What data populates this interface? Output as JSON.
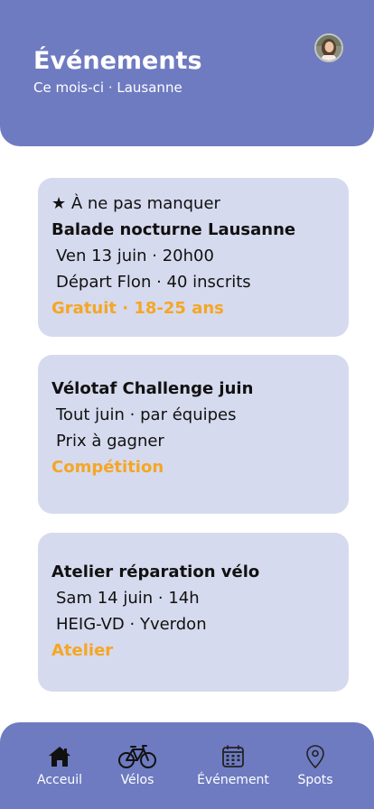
{
  "header": {
    "title": "Événements",
    "subtitle": "Ce mois-ci · Lausanne"
  },
  "events": [
    {
      "highlight": "★ À ne pas manquer",
      "title": "Balade nocturne Lausanne",
      "line1": "Ven 13 juin · 20h00",
      "line2": "Départ Flon · 40 inscrits",
      "tag": "Gratuit · 18-25 ans"
    },
    {
      "title": "Vélotaf Challenge juin",
      "line1": "Tout juin · par équipes",
      "line2": "Prix à gagner",
      "tag": "Compétition"
    },
    {
      "title": "Atelier réparation vélo",
      "line1": "Sam 14 juin · 14h",
      "line2": "HEIG-VD · Yverdon",
      "tag": "Atelier"
    }
  ],
  "nav": [
    {
      "label": "Acceuil",
      "icon": "home-icon"
    },
    {
      "label": "Vélos",
      "icon": "bicycle-icon"
    },
    {
      "label": "Événement",
      "icon": "calendar-icon"
    },
    {
      "label": "Spots",
      "icon": "map-pin-icon"
    }
  ],
  "colors": {
    "primary": "#6e7bc1",
    "card": "#d6daee",
    "accent": "#f5a623"
  }
}
